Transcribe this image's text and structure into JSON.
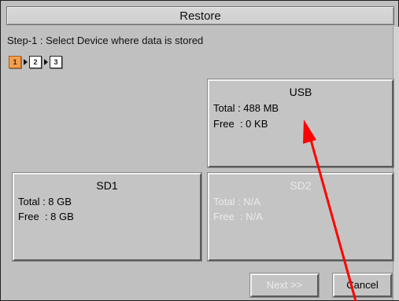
{
  "window": {
    "title": "Restore"
  },
  "instruction": "Step-1 : Select Device where data is stored",
  "steps": [
    {
      "label": "1",
      "active": true
    },
    {
      "label": "2",
      "active": false
    },
    {
      "label": "3",
      "active": false
    }
  ],
  "devices": {
    "usb": {
      "name": "USB",
      "total": "Total : 488 MB",
      "free": "Free  : 0 KB",
      "enabled": true
    },
    "sd1": {
      "name": "SD1",
      "total": "Total : 8 GB",
      "free": "Free  : 8 GB",
      "enabled": true
    },
    "sd2": {
      "name": "SD2",
      "total": "Total : N/A",
      "free": "Free  : N/A",
      "enabled": false
    }
  },
  "buttons": {
    "next": {
      "label": "Next >>",
      "enabled": false
    },
    "cancel": {
      "label": "Cancel",
      "enabled": true
    }
  },
  "annotation": {
    "arrow_color": "#ff0000"
  }
}
